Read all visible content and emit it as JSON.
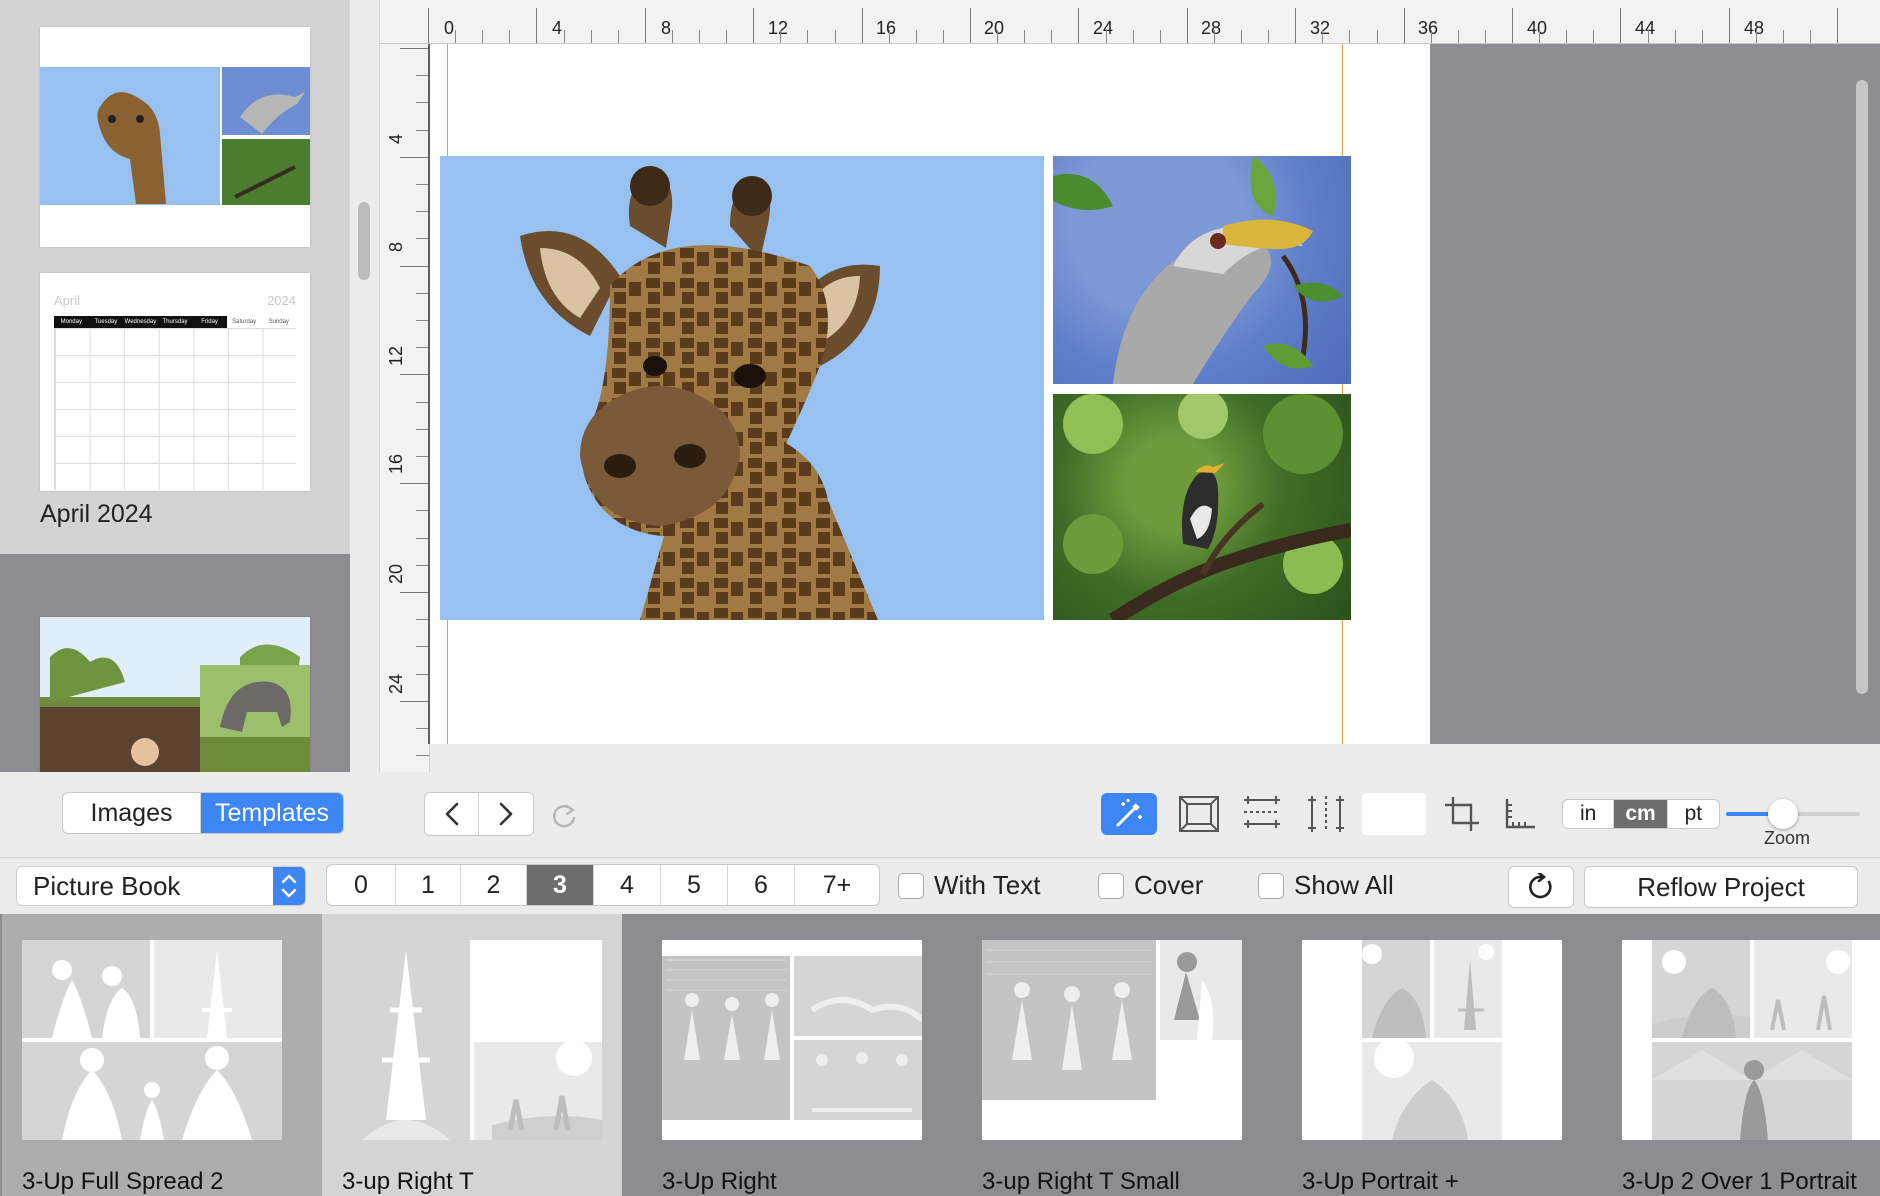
{
  "sidebar": {
    "pages": [
      {
        "name": "page-giraffe-spread"
      },
      {
        "name": "page-calendar",
        "label": "April 2024",
        "calendar": {
          "month": "April",
          "year": "2024",
          "days": [
            "Monday",
            "Tuesday",
            "Wednesday",
            "Thursday",
            "Friday",
            "Saturday",
            "Sunday"
          ]
        }
      },
      {
        "name": "page-elephant-spread"
      }
    ]
  },
  "ruler": {
    "top_labels": [
      "0",
      "4",
      "8",
      "12",
      "16",
      "20",
      "24",
      "28",
      "32",
      "36",
      "40",
      "44",
      "48"
    ],
    "left_labels": [
      "4",
      "8",
      "12",
      "16",
      "20",
      "24"
    ]
  },
  "toolbar": {
    "mode_tabs": [
      {
        "label": "Images",
        "selected": false
      },
      {
        "label": "Templates",
        "selected": true
      }
    ],
    "nav_prev_icon": "chevron-left-icon",
    "nav_next_icon": "chevron-right-icon",
    "redo_icon": "redo-icon",
    "tools": [
      "magic-wand-icon",
      "frame-fit-icon",
      "horizontal-guides-icon",
      "vertical-guides-icon",
      "color-swatch",
      "crop-icon",
      "ruler-icon"
    ],
    "units": [
      {
        "label": "in",
        "selected": false
      },
      {
        "label": "cm",
        "selected": true
      },
      {
        "label": "pt",
        "selected": false
      }
    ],
    "zoom_label": "Zoom",
    "zoom_level": 0.35,
    "accent": "#3d86f3"
  },
  "options": {
    "book_type": "Picture Book",
    "counts": [
      "0",
      "1",
      "2",
      "3",
      "4",
      "5",
      "6",
      "7+"
    ],
    "selected_count": "3",
    "with_text": "With Text",
    "cover": "Cover",
    "show_all": "Show All",
    "refresh_icon": "refresh-icon",
    "reflow": "Reflow Project"
  },
  "templates": [
    {
      "label": "3-Up Full Spread 2"
    },
    {
      "label": "3-up Right T"
    },
    {
      "label": "3-Up Right"
    },
    {
      "label": "3-up Right T Small"
    },
    {
      "label": "3-Up Portrait +"
    },
    {
      "label": "3-Up 2 Over 1 Portrait"
    }
  ]
}
